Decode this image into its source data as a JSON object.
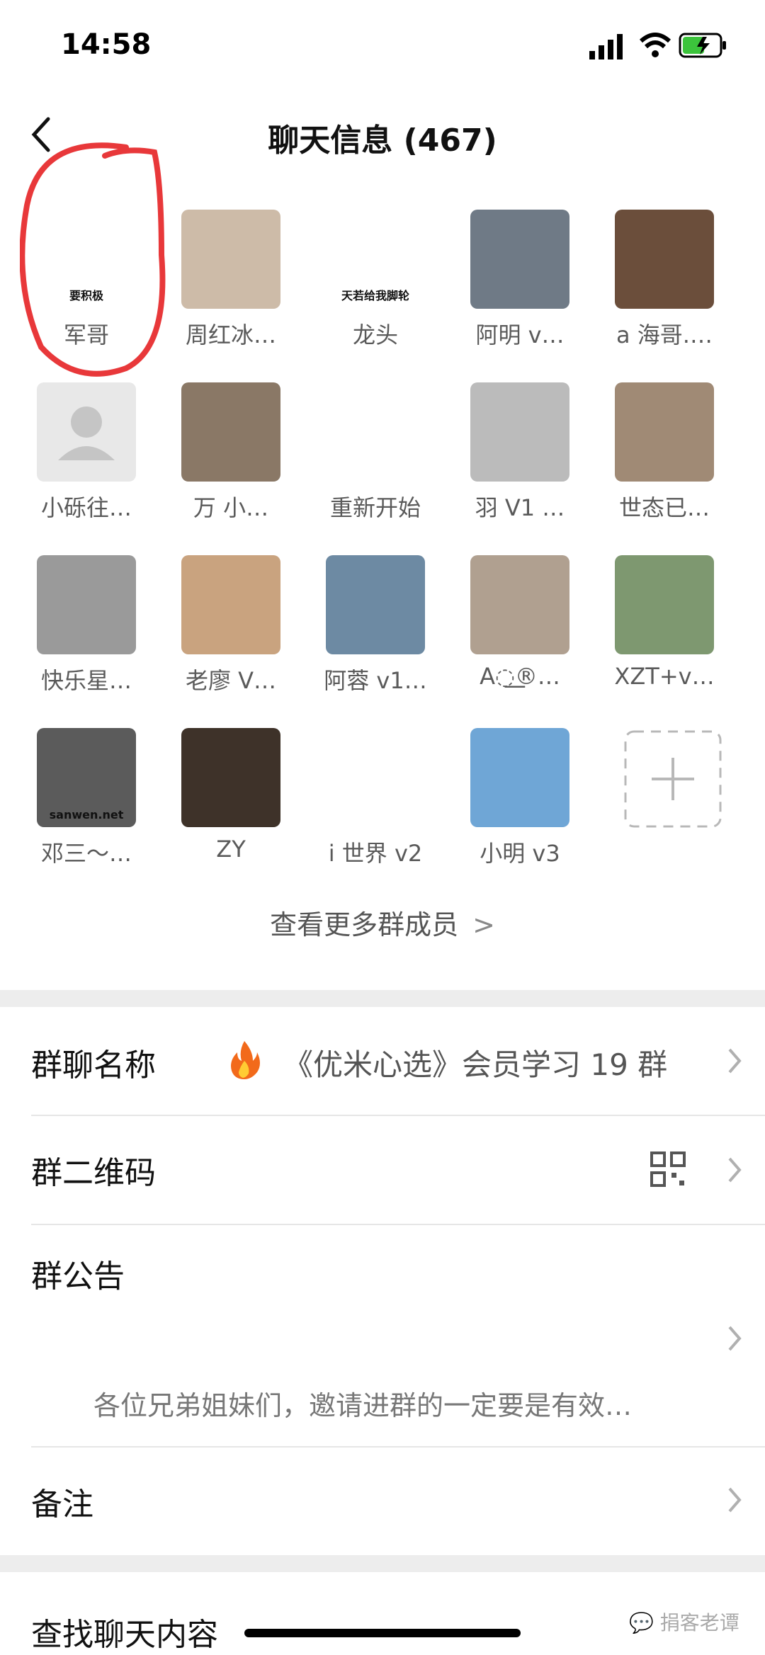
{
  "status": {
    "time": "14:58"
  },
  "nav": {
    "title": "聊天信息 (467)"
  },
  "members": [
    {
      "name": "军哥",
      "badge": "要积极",
      "color": "#ffffff"
    },
    {
      "name": "周红冰…",
      "color": "#cdbba8"
    },
    {
      "name": "龙头",
      "badge": "天若给我脚轮",
      "color": "#ffffff"
    },
    {
      "name": "阿明 v…",
      "color": "#6f7a86"
    },
    {
      "name": "a 海哥.…",
      "color": "#6b4e3b"
    },
    {
      "name": "小砾往…",
      "color": "#e8e8e8"
    },
    {
      "name": "万 小…",
      "color": "#8a7866"
    },
    {
      "name": "重新开始",
      "color": "#ffffff"
    },
    {
      "name": "羽 V1 …",
      "color": "#bbbbbb"
    },
    {
      "name": "世态已…",
      "color": "#a08a75"
    },
    {
      "name": "快乐星…",
      "color": "#9a9a9a"
    },
    {
      "name": "老廖 V…",
      "color": "#c9a37f"
    },
    {
      "name": "阿蓉 v1…",
      "color": "#6d8aa3"
    },
    {
      "name": "A◌͟͟®…",
      "color": "#b0a090"
    },
    {
      "name": "XZT+v…",
      "color": "#7e9870"
    },
    {
      "name": "邓三～…",
      "badge": "sanwen.net",
      "color": "#5b5b5b"
    },
    {
      "name": "ZY",
      "color": "#3e3229"
    },
    {
      "name": "i 世界 v2",
      "color": "#ffffff"
    },
    {
      "name": "小明 v3",
      "color": "#6fa6d6"
    }
  ],
  "more_label": "查看更多群成员",
  "settings": {
    "group_name_label": "群聊名称",
    "group_name_value": "《优米心选》会员学习 19 群",
    "qr_label": "群二维码",
    "notice_label": "群公告",
    "notice_text": "各位兄弟姐妹们，邀请进群的一定要是有效…",
    "remark_label": "备注",
    "search_label": "查找聊天内容"
  },
  "watermark": "捐客老谭"
}
